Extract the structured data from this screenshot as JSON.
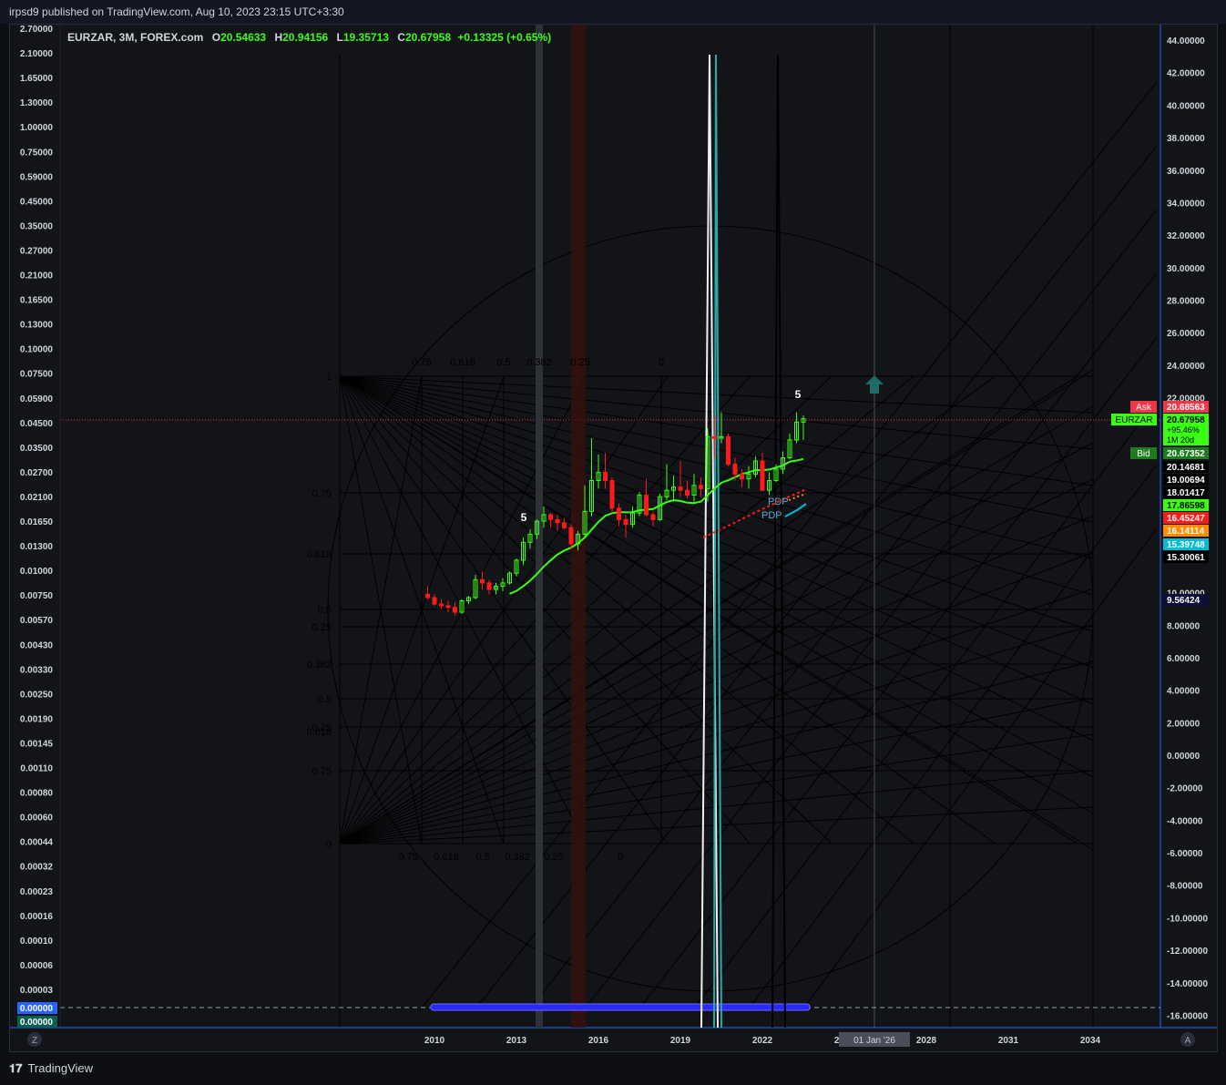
{
  "header": {
    "published_text": "irpsd9 published on TradingView.com, Aug 10, 2023 23:15 UTC+3:30"
  },
  "legend": {
    "symbol": "EURZAR, 3M, FOREX.com",
    "open_label": "O",
    "open": "20.54633",
    "high_label": "H",
    "high": "20.94156",
    "low_label": "L",
    "low": "19.35713",
    "close_label": "C",
    "close": "20.67958",
    "change": "+0.13325 (+0.65%)"
  },
  "footer": {
    "brand": "TradingView"
  },
  "colors": {
    "up": "#39ff14",
    "down": "#ff1a1a",
    "bg": "#131418",
    "axis": "#2962ff"
  },
  "chart_data": {
    "type": "candlestick",
    "x_ticks": [
      "2010",
      "2013",
      "2016",
      "2019",
      "2022",
      "2025",
      "2028",
      "2031",
      "2034"
    ],
    "crosshair_x_label": "01 Jan '26",
    "right_axis_ticks": [
      "44.00000",
      "42.00000",
      "40.00000",
      "38.00000",
      "36.00000",
      "34.00000",
      "32.00000",
      "30.00000",
      "28.00000",
      "26.00000",
      "24.00000",
      "22.00000",
      "10.00000",
      "8.00000",
      "6.00000",
      "4.00000",
      "2.00000",
      "0.00000",
      "-2.00000",
      "-4.00000",
      "-6.00000",
      "-8.00000",
      "-10.00000",
      "-12.00000",
      "-14.00000",
      "-16.00000"
    ],
    "left_axis_ticks": [
      "2.70000",
      "2.10000",
      "1.65000",
      "1.30000",
      "1.00000",
      "0.75000",
      "0.59000",
      "0.45000",
      "0.35000",
      "0.27000",
      "0.21000",
      "0.16500",
      "0.13000",
      "0.10000",
      "0.07500",
      "0.05900",
      "0.04500",
      "0.03500",
      "0.02700",
      "0.02100",
      "0.01650",
      "0.01300",
      "0.01000",
      "0.00750",
      "0.00570",
      "0.00430",
      "0.00330",
      "0.00250",
      "0.00190",
      "0.00145",
      "0.00110",
      "0.00080",
      "0.00060",
      "0.00044",
      "0.00032",
      "0.00023",
      "0.00016",
      "0.00010",
      "0.00006",
      "0.00003"
    ],
    "left_axis_badges": [
      "0.00000",
      "0.00000"
    ],
    "price_labels": [
      {
        "tag": "Ask",
        "value": "20.68563",
        "color": "#f23645"
      },
      {
        "tag": "EURZAR",
        "value": "20.67958",
        "extra": [
          "+95.46%",
          "1M 20d"
        ],
        "color": "#39ff14"
      },
      {
        "tag": "Bid",
        "value": "20.67352",
        "color": "#1e7b1e"
      },
      {
        "value": "20.14681",
        "color": "#000000"
      },
      {
        "value": "19.00694",
        "color": "#000000"
      },
      {
        "value": "18.01417",
        "color": "#000000"
      },
      {
        "value": "17.86598",
        "color": "#39ff14"
      },
      {
        "value": "16.45247",
        "color": "#ff1a1a"
      },
      {
        "value": "16.14114",
        "color": "#ff8c00"
      },
      {
        "value": "15.39748",
        "color": "#00bcd4"
      },
      {
        "value": "15.30061",
        "color": "#000000"
      },
      {
        "value": "9.56424",
        "color": "#0d0d3a"
      }
    ],
    "wave_labels": [
      "5",
      "5"
    ],
    "pdp_labels": [
      "PDP",
      "PDP"
    ],
    "fib_left_labels": [
      "1",
      "0.75",
      "0.618",
      "0.5",
      "0.25",
      "0.382",
      "0.5",
      "0.25",
      "0.618",
      "0.75",
      "0"
    ],
    "fib_top_labels": [
      "0.75",
      "0.618",
      "0.5",
      "0.382",
      "0.25",
      "0"
    ],
    "fib_bottom_labels": [
      "0.75",
      "0.618",
      "0.5",
      "0.382",
      "0.25",
      "0"
    ],
    "scale_buttons": [
      "Z",
      "A"
    ],
    "candles": [
      {
        "t": "2009Q4",
        "o": 9.9,
        "h": 10.4,
        "l": 9.6,
        "c": 9.7
      },
      {
        "t": "2010Q1",
        "o": 9.7,
        "h": 9.9,
        "l": 9.2,
        "c": 9.3
      },
      {
        "t": "2010Q2",
        "o": 9.3,
        "h": 9.6,
        "l": 9.0,
        "c": 9.2
      },
      {
        "t": "2010Q3",
        "o": 9.2,
        "h": 9.5,
        "l": 8.8,
        "c": 9.1
      },
      {
        "t": "2010Q4",
        "o": 9.1,
        "h": 9.4,
        "l": 8.6,
        "c": 8.8
      },
      {
        "t": "2011Q1",
        "o": 8.8,
        "h": 9.6,
        "l": 8.7,
        "c": 9.5
      },
      {
        "t": "2011Q2",
        "o": 9.5,
        "h": 9.8,
        "l": 9.3,
        "c": 9.7
      },
      {
        "t": "2011Q3",
        "o": 9.7,
        "h": 11.1,
        "l": 9.6,
        "c": 10.8
      },
      {
        "t": "2011Q4",
        "o": 10.8,
        "h": 11.3,
        "l": 10.2,
        "c": 10.6
      },
      {
        "t": "2012Q1",
        "o": 10.6,
        "h": 10.8,
        "l": 9.9,
        "c": 10.2
      },
      {
        "t": "2012Q2",
        "o": 10.2,
        "h": 10.6,
        "l": 9.9,
        "c": 10.4
      },
      {
        "t": "2012Q3",
        "o": 10.4,
        "h": 10.9,
        "l": 10.1,
        "c": 10.6
      },
      {
        "t": "2012Q4",
        "o": 10.6,
        "h": 11.3,
        "l": 10.5,
        "c": 11.2
      },
      {
        "t": "2013Q1",
        "o": 11.2,
        "h": 12.1,
        "l": 11.0,
        "c": 12.0
      },
      {
        "t": "2013Q2",
        "o": 12.0,
        "h": 13.4,
        "l": 11.7,
        "c": 13.1
      },
      {
        "t": "2013Q3",
        "o": 13.1,
        "h": 13.9,
        "l": 12.7,
        "c": 13.6
      },
      {
        "t": "2013Q4",
        "o": 13.6,
        "h": 14.5,
        "l": 13.3,
        "c": 14.4
      },
      {
        "t": "2014Q1",
        "o": 14.4,
        "h": 15.3,
        "l": 14.0,
        "c": 14.8
      },
      {
        "t": "2014Q2",
        "o": 14.8,
        "h": 14.9,
        "l": 14.0,
        "c": 14.5
      },
      {
        "t": "2014Q3",
        "o": 14.5,
        "h": 14.8,
        "l": 13.8,
        "c": 14.3
      },
      {
        "t": "2014Q4",
        "o": 14.3,
        "h": 14.6,
        "l": 13.9,
        "c": 14.0
      },
      {
        "t": "2015Q1",
        "o": 14.0,
        "h": 14.2,
        "l": 12.7,
        "c": 13.0
      },
      {
        "t": "2015Q2",
        "o": 13.0,
        "h": 13.8,
        "l": 12.6,
        "c": 13.6
      },
      {
        "t": "2015Q3",
        "o": 13.6,
        "h": 16.6,
        "l": 13.4,
        "c": 15.0
      },
      {
        "t": "2015Q4",
        "o": 15.0,
        "h": 19.5,
        "l": 14.7,
        "c": 16.9
      },
      {
        "t": "2016Q1",
        "o": 16.9,
        "h": 18.5,
        "l": 16.4,
        "c": 17.4
      },
      {
        "t": "2016Q2",
        "o": 17.4,
        "h": 18.6,
        "l": 16.4,
        "c": 16.9
      },
      {
        "t": "2016Q3",
        "o": 16.9,
        "h": 17.1,
        "l": 14.9,
        "c": 15.2
      },
      {
        "t": "2016Q4",
        "o": 15.2,
        "h": 15.5,
        "l": 14.1,
        "c": 14.5
      },
      {
        "t": "2017Q1",
        "o": 14.5,
        "h": 14.8,
        "l": 13.4,
        "c": 14.2
      },
      {
        "t": "2017Q2",
        "o": 14.2,
        "h": 15.3,
        "l": 14.0,
        "c": 14.9
      },
      {
        "t": "2017Q3",
        "o": 14.9,
        "h": 16.2,
        "l": 14.7,
        "c": 16.0
      },
      {
        "t": "2017Q4",
        "o": 16.0,
        "h": 17.0,
        "l": 14.7,
        "c": 14.8
      },
      {
        "t": "2018Q1",
        "o": 14.8,
        "h": 15.0,
        "l": 14.1,
        "c": 14.5
      },
      {
        "t": "2018Q2",
        "o": 14.5,
        "h": 16.1,
        "l": 14.4,
        "c": 15.9
      },
      {
        "t": "2018Q3",
        "o": 15.9,
        "h": 17.9,
        "l": 15.7,
        "c": 16.3
      },
      {
        "t": "2018Q4",
        "o": 16.3,
        "h": 17.2,
        "l": 15.6,
        "c": 16.5
      },
      {
        "t": "2019Q1",
        "o": 16.5,
        "h": 18.1,
        "l": 15.9,
        "c": 16.3
      },
      {
        "t": "2019Q2",
        "o": 16.3,
        "h": 16.9,
        "l": 15.8,
        "c": 16.0
      },
      {
        "t": "2019Q3",
        "o": 16.0,
        "h": 17.3,
        "l": 15.6,
        "c": 16.6
      },
      {
        "t": "2019Q4",
        "o": 16.6,
        "h": 17.1,
        "l": 15.9,
        "c": 16.4
      },
      {
        "t": "2020Q1",
        "o": 16.4,
        "h": 20.1,
        "l": 15.6,
        "c": 19.6
      },
      {
        "t": "2020Q2",
        "o": 19.6,
        "h": 20.9,
        "l": 18.3,
        "c": 19.5
      },
      {
        "t": "2020Q3",
        "o": 19.5,
        "h": 21.1,
        "l": 19.2,
        "c": 19.6
      },
      {
        "t": "2020Q4",
        "o": 19.6,
        "h": 19.8,
        "l": 17.8,
        "c": 17.9
      },
      {
        "t": "2021Q1",
        "o": 17.9,
        "h": 18.3,
        "l": 16.9,
        "c": 17.3
      },
      {
        "t": "2021Q2",
        "o": 17.3,
        "h": 17.6,
        "l": 16.5,
        "c": 17.0
      },
      {
        "t": "2021Q3",
        "o": 17.0,
        "h": 17.8,
        "l": 16.4,
        "c": 17.3
      },
      {
        "t": "2021Q4",
        "o": 17.3,
        "h": 18.4,
        "l": 17.1,
        "c": 18.1
      },
      {
        "t": "2022Q1",
        "o": 18.1,
        "h": 18.6,
        "l": 16.5,
        "c": 16.3
      },
      {
        "t": "2022Q2",
        "o": 16.3,
        "h": 17.4,
        "l": 16.0,
        "c": 16.9
      },
      {
        "t": "2022Q3",
        "o": 16.9,
        "h": 17.9,
        "l": 16.8,
        "c": 17.6
      },
      {
        "t": "2022Q4",
        "o": 17.6,
        "h": 18.7,
        "l": 17.3,
        "c": 18.3
      },
      {
        "t": "2023Q1",
        "o": 18.3,
        "h": 19.8,
        "l": 18.2,
        "c": 19.4
      },
      {
        "t": "2023Q2",
        "o": 19.4,
        "h": 21.1,
        "l": 19.2,
        "c": 20.5
      },
      {
        "t": "2023Q3",
        "o": 20.5,
        "h": 20.9,
        "l": 19.4,
        "c": 20.7
      }
    ]
  }
}
